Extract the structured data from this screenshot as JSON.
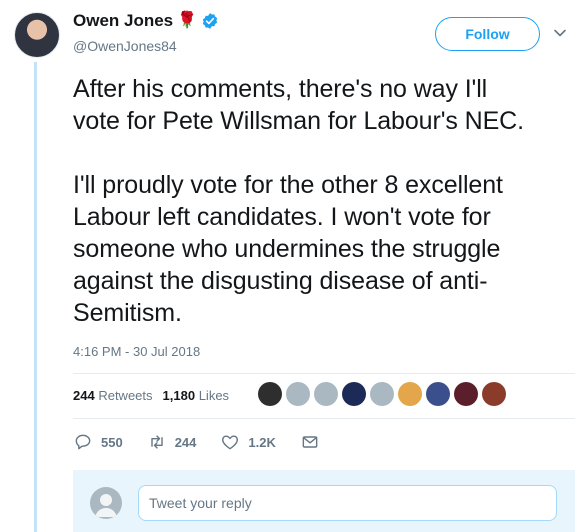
{
  "author": {
    "name": "Owen Jones",
    "handle": "@OwenJones84",
    "rose_emoji": "🌹",
    "verified": true
  },
  "follow_label": "Follow",
  "tweet": {
    "text": "After his comments, there's no way I'll\nvote for Pete Willsman for Labour's NEC.\n\nI'll proudly vote for the other 8 excellent\nLabour left candidates. I won't vote for\nsomeone who undermines the struggle\nagainst the disgusting disease of anti-\nSemitism.",
    "timestamp": "4:16 PM - 30 Jul 2018"
  },
  "stats": {
    "retweets_count": "244",
    "retweets_label": "Retweets",
    "likes_count": "1,180",
    "likes_label": "Likes"
  },
  "liker_avatars": [
    "#2e2e2e",
    "#aab8c2",
    "#aab8c2",
    "#1c2a57",
    "#aab8c2",
    "#e3a64a",
    "#3a4f8c",
    "#5a1f2a",
    "#8a3b2a"
  ],
  "actions": {
    "reply_count": "550",
    "retweet_count": "244",
    "like_count": "1.2K"
  },
  "reply": {
    "placeholder": "Tweet your reply"
  },
  "colors": {
    "accent": "#1da1f2",
    "muted": "#657786",
    "thread_line": "#c5e3f8"
  }
}
